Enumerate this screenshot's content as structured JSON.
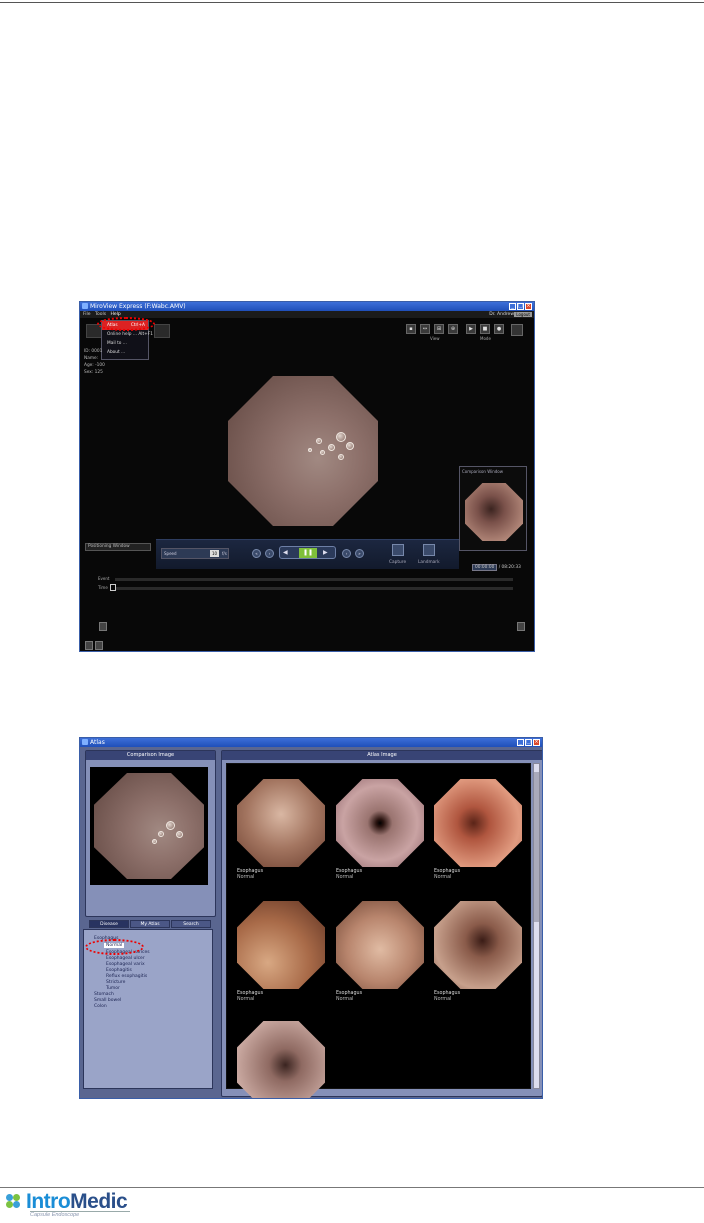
{
  "window1": {
    "title": "MiroView Express (F:Wabc.AMV)",
    "menu": [
      "File",
      "Tools",
      "Help"
    ],
    "user": "Dr. Andrew",
    "logout": "Logout",
    "help_menu": [
      "Atlas",
      "Ctrl+A",
      "Online help ...",
      "Alt+F1",
      "Mail to ...",
      "About ..."
    ],
    "patient_info": [
      "ID: 0001",
      "Name:",
      "Age: -100",
      "Sex: 125"
    ],
    "view_label": "View",
    "mode_label": "Mode",
    "comparison_window": "Comparison Window",
    "positioning_window": "Positioning Window",
    "speed_label": "Speed",
    "speed_value": "10",
    "speed_unit": "f/s",
    "capture": "Capture",
    "landmark": "Landmark",
    "time_current": "00:00:00",
    "time_total": "/ 08:20:33",
    "timeline_labels": [
      "Event",
      "Time"
    ]
  },
  "window2": {
    "title": "Atlas",
    "comparison_image": "Comparison Image",
    "atlas_image": "Atlas Image",
    "tabs": [
      "Disease",
      "My Atlas",
      "Search"
    ],
    "tree": [
      "Esophagus",
      "Normal",
      "Esophageal varices",
      "Esophageal ulcer",
      "Esophageal varix",
      "Esophagitis",
      "Reflux esophagitis",
      "Stricture",
      "Tumor",
      "Stomach",
      "Small bowel",
      "Colon"
    ],
    "thumbnails": [
      {
        "organ": "Esophagus",
        "status": "Normal"
      },
      {
        "organ": "Esophagus",
        "status": "Normal"
      },
      {
        "organ": "Esophagus",
        "status": "Normal"
      },
      {
        "organ": "Esophagus",
        "status": "Normal"
      },
      {
        "organ": "Esophagus",
        "status": "Normal"
      },
      {
        "organ": "Esophagus",
        "status": "Normal"
      }
    ]
  },
  "footer": {
    "logo_intro": "Intro",
    "logo_medic": "Medic",
    "tagline": "Capsule Endoscope"
  }
}
